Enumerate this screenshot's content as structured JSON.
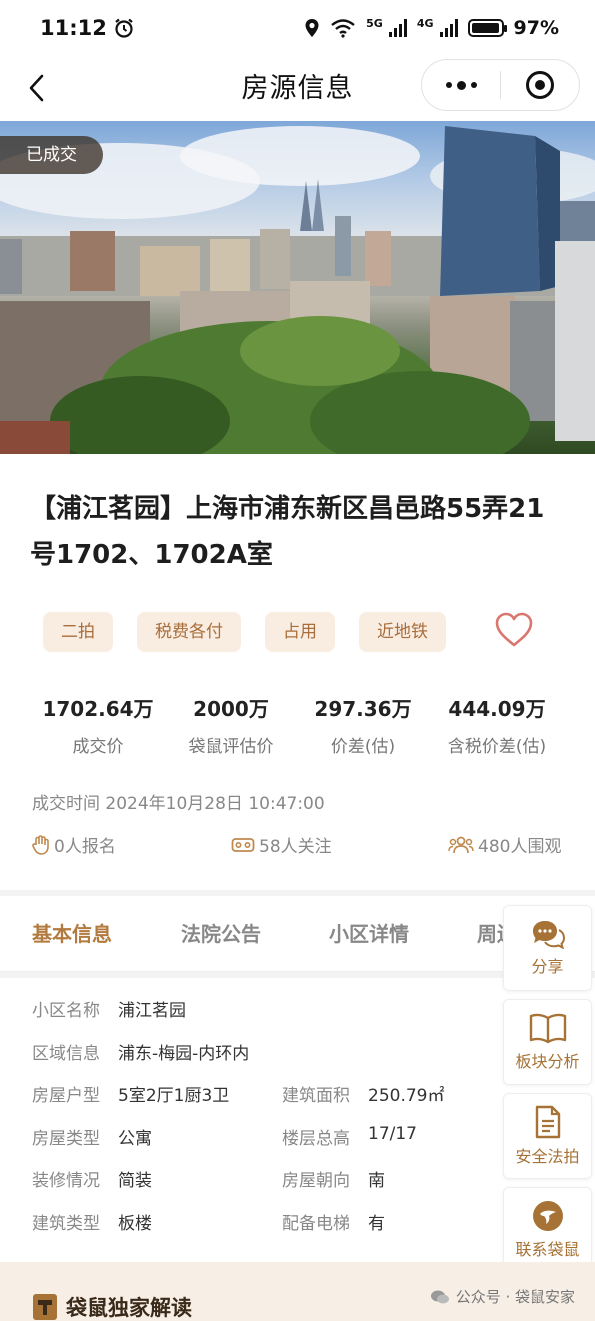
{
  "status_bar": {
    "time": "11:12",
    "network_1": "5G",
    "network_2": "4G",
    "battery": "97%",
    "battery_level": 0.97
  },
  "nav": {
    "title": "房源信息"
  },
  "hero": {
    "badge": "已成交"
  },
  "listing": {
    "title": "【浦江茗园】上海市浦东新区昌邑路55弄21号1702、1702A室",
    "tags": [
      "二拍",
      "税费各付",
      "占用",
      "近地铁"
    ],
    "prices": [
      {
        "value": "1702.64万",
        "label": "成交价"
      },
      {
        "value": "2000万",
        "label": "袋鼠评估价"
      },
      {
        "value": "297.36万",
        "label": "价差(估)"
      },
      {
        "value": "444.09万",
        "label": "含税价差(估)"
      }
    ],
    "deal_time": "成交时间 2024年10月28日 10:47:00",
    "stats": {
      "signups": "0人报名",
      "followers": "58人关注",
      "viewers": "480人围观"
    }
  },
  "tabs": [
    "基本信息",
    "法院公告",
    "小区详情",
    "周边"
  ],
  "info": {
    "rows": [
      {
        "k": "小区名称",
        "v": "浦江茗园"
      },
      {
        "k": "区域信息",
        "v": "浦东-梅园-内环内"
      },
      {
        "k": "房屋户型",
        "v": "5室2厅1厨3卫",
        "k2": "建筑面积",
        "v2": "250.79㎡"
      },
      {
        "k": "房屋类型",
        "v": "公寓",
        "k2": "楼层总高",
        "v2": "17/17"
      },
      {
        "k": "装修情况",
        "v": "简装",
        "k2": "房屋朝向",
        "v2": "南"
      },
      {
        "k": "建筑类型",
        "v": "板楼",
        "k2": "配备电梯",
        "v2": "有"
      }
    ]
  },
  "float_menu": [
    "分享",
    "板块分析",
    "安全法拍",
    "联系袋鼠"
  ],
  "bottom": {
    "title": "袋鼠独家解读",
    "watermark": "公众号 · 袋鼠安家"
  },
  "colors": {
    "accent": "#b27a3e",
    "tag_bg": "#f9ece0",
    "tag_text": "#a86e3c",
    "heart": "#d9776e"
  }
}
